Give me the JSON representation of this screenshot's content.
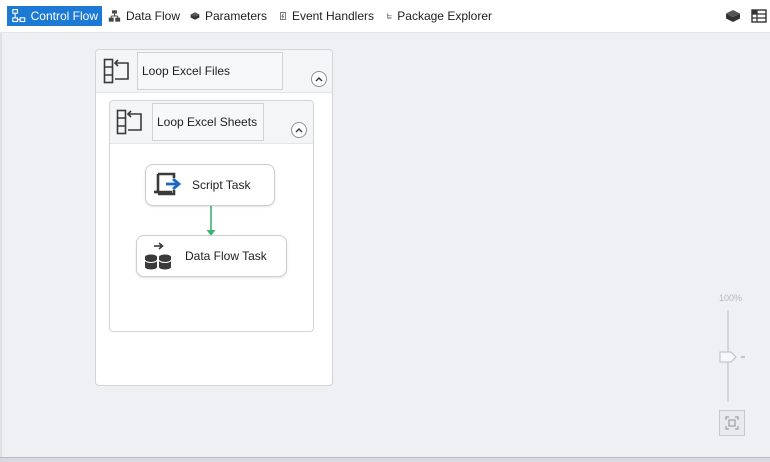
{
  "toolbar": {
    "tabs": [
      {
        "label": "Control Flow",
        "icon": "control-flow-icon",
        "active": true
      },
      {
        "label": "Data Flow",
        "icon": "data-flow-icon",
        "active": false
      },
      {
        "label": "Parameters",
        "icon": "parameters-icon",
        "active": false
      },
      {
        "label": "Event Handlers",
        "icon": "event-handlers-icon",
        "active": false
      },
      {
        "label": "Package Explorer",
        "icon": "package-explorer-icon",
        "active": false
      }
    ],
    "right_icons": [
      "package-icon",
      "variables-grid-icon"
    ]
  },
  "canvas": {
    "outer_container": {
      "title": "Loop Excel Files",
      "icon": "foreach-loop-icon"
    },
    "inner_container": {
      "title": "Loop Excel Sheets",
      "icon": "foreach-loop-icon"
    },
    "tasks": [
      {
        "label": "Script Task",
        "icon": "script-task-icon"
      },
      {
        "label": "Data Flow Task",
        "icon": "data-flow-task-icon"
      }
    ],
    "precedence_color": "#3cb371"
  },
  "zoom": {
    "label": "100%"
  },
  "colors": {
    "accent": "#1c7ad4",
    "canvas": "#eef0f4"
  }
}
